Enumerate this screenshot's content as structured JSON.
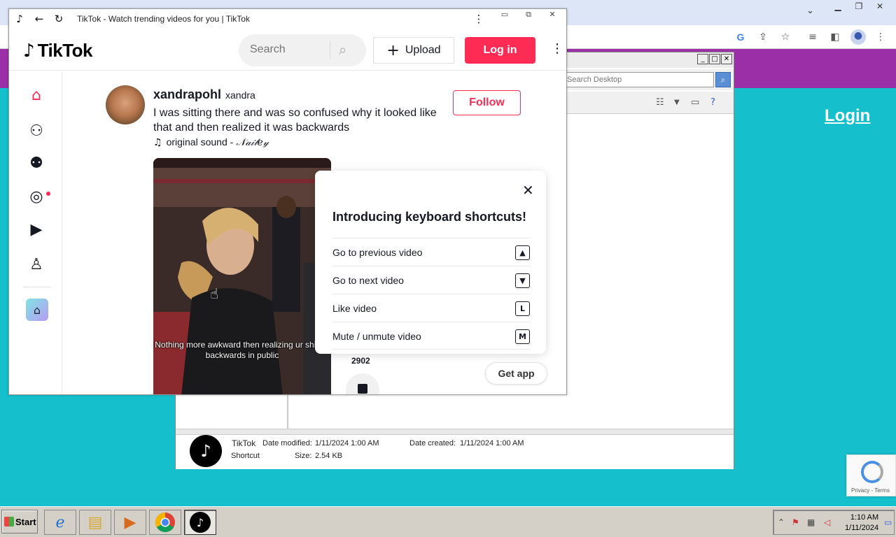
{
  "background_browser": {
    "login_label": "Login"
  },
  "explorer": {
    "search_placeholder": "Search Desktop",
    "details": {
      "name": "TikTok",
      "type": "Shortcut",
      "date_modified_label": "Date modified:",
      "date_modified": "1/11/2024 1:00 AM",
      "date_created_label": "Date created:",
      "date_created": "1/11/2024 1:00 AM",
      "size_label": "Size:",
      "size": "2.54 KB"
    }
  },
  "tiktok": {
    "window_title": "TikTok - Watch trending videos for you | TikTok",
    "logo_text": "TikTok",
    "search_placeholder": "Search",
    "upload_label": "Upload",
    "login_label": "Log in",
    "post": {
      "username": "xandrapohl",
      "nickname": "xandra",
      "caption": "I was sitting there and was so confused why it looked like that and then realized it was backwards",
      "music_prefix": "original sound - ",
      "music_artist": "𝒩𝒶𝒾𝓁𝑒𝓎",
      "follow_label": "Follow",
      "video_caption": "Nothing more awkward then realizing ur shirt is backwards in public",
      "like_count": "2902"
    },
    "get_app_label": "Get app",
    "shortcuts_popup": {
      "title": "Introducing keyboard shortcuts!",
      "items": [
        {
          "label": "Go to previous video",
          "key": "▲"
        },
        {
          "label": "Go to next video",
          "key": "▼"
        },
        {
          "label": "Like video",
          "key": "L"
        },
        {
          "label": "Mute / unmute video",
          "key": "M"
        }
      ]
    }
  },
  "recaptcha": {
    "footer": "Privacy - Terms"
  },
  "taskbar": {
    "start_label": "Start",
    "clock_time": "1:10 AM",
    "clock_date": "1/11/2024"
  },
  "colors": {
    "tiktok_red": "#fe2c55",
    "desktop_teal": "#15c0cc",
    "site_purple": "#9a2fa8"
  }
}
